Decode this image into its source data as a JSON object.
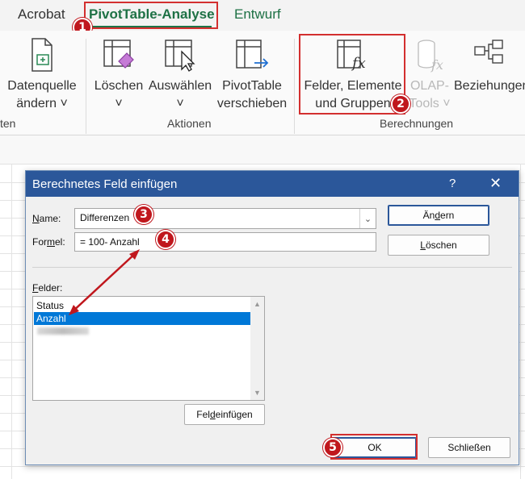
{
  "ribbon_tabs": [
    {
      "label": "Acrobat"
    },
    {
      "label": "PivotTable-Analyse"
    },
    {
      "label": "Entwurf"
    }
  ],
  "ribbon": {
    "datasource": {
      "line1": "Datenquelle",
      "line2": "ändern ˅"
    },
    "loeschen": {
      "line1": "Löschen",
      "line2": "˅"
    },
    "auswaehlen": {
      "line1": "Auswählen",
      "line2": "˅"
    },
    "verschieben": {
      "line1": "PivotTable",
      "line2": "verschieben"
    },
    "felder": {
      "line1": "Felder, Elemente",
      "line2": "und Gruppen"
    },
    "olap": {
      "line1": "OLAP-",
      "line2": "Tools ˅"
    },
    "beziehungen": {
      "line1": "Beziehungen"
    },
    "group_daten_fragment": "ten",
    "group_aktionen": "Aktionen",
    "group_berechnungen": "Berechnungen"
  },
  "badges": [
    "1",
    "2",
    "3",
    "4",
    "5"
  ],
  "dialog": {
    "title": "Berechnetes Feld einfügen",
    "help": "?",
    "close": "✕",
    "name_label_u": "N",
    "name_label_rest": "ame:",
    "name_value": "Differenzen",
    "formula_label_pre": "For",
    "formula_label_u": "m",
    "formula_label_post": "el:",
    "formula_value": "= 100- Anzahl",
    "fields_label_u": "F",
    "fields_label_rest": "elder:",
    "fields": [
      "Status",
      "Anzahl"
    ],
    "selected_field": "Anzahl",
    "btn_aendern_pre": "Än",
    "btn_aendern_u": "d",
    "btn_aendern_post": "ern",
    "btn_loeschen_u": "L",
    "btn_loeschen_rest": "öschen",
    "btn_feld_pre": "Fel",
    "btn_feld_u": "d",
    "btn_feld_post": " einfügen",
    "btn_ok": "OK",
    "btn_schliessen": "Schließen"
  },
  "colors": {
    "accent_green": "#1e7145",
    "title_blue": "#2b579a",
    "selection_blue": "#0078d7",
    "annotation_red": "#c0171d"
  }
}
